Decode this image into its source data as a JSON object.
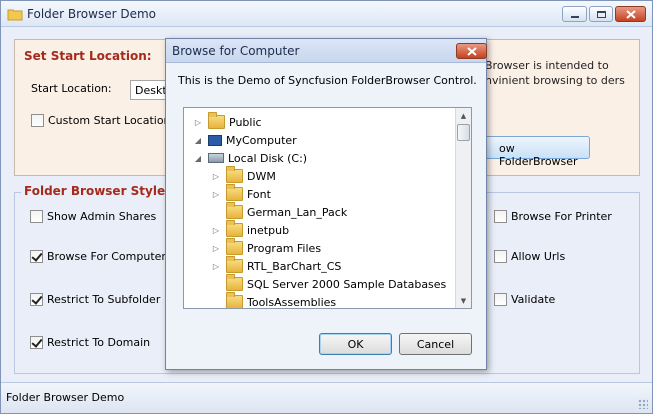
{
  "window": {
    "title": "Folder Browser Demo"
  },
  "start_panel": {
    "header": "Set Start Location:",
    "start_location_label": "Start Location:",
    "start_location_value": "Desktop",
    "custom_start_label": "Custom Start Location",
    "custom_start_checked": false,
    "description": "Browser is intended to nvinient browsing to ders",
    "show_button_label": "ow FolderBrowser"
  },
  "styles_panel": {
    "header": "Folder Browser Styles",
    "options_left": [
      {
        "label": "Show Admin Shares",
        "checked": false
      },
      {
        "label": "Browse For Computer",
        "checked": true
      },
      {
        "label": "Restrict  To Subfolder",
        "checked": true
      },
      {
        "label": "Restrict To Domain",
        "checked": true
      }
    ],
    "options_right": [
      {
        "label": "Browse For Printer",
        "checked": false
      },
      {
        "label": "Allow Urls",
        "checked": false
      },
      {
        "label": "Validate",
        "checked": false
      }
    ]
  },
  "status": {
    "text": "Folder Browser Demo"
  },
  "dialog": {
    "title": "Browse for Computer",
    "message": "This is the Demo of Syncfusion FolderBrowser Control.",
    "tree": [
      {
        "label": "Public",
        "level": 0,
        "expander": "collapsed",
        "icon": "folder-icon"
      },
      {
        "label": "MyComputer",
        "level": 0,
        "expander": "expanded",
        "icon": "computer-icon"
      },
      {
        "label": "Local Disk (C:)",
        "level": 1,
        "expander": "expanded",
        "icon": "disk-icon"
      },
      {
        "label": "DWM",
        "level": 2,
        "expander": "collapsed",
        "icon": "folder-icon"
      },
      {
        "label": "Font",
        "level": 2,
        "expander": "collapsed",
        "icon": "folder-icon"
      },
      {
        "label": "German_Lan_Pack",
        "level": 2,
        "expander": "none",
        "icon": "folder-icon"
      },
      {
        "label": "inetpub",
        "level": 2,
        "expander": "collapsed",
        "icon": "folder-icon"
      },
      {
        "label": "Program Files",
        "level": 2,
        "expander": "collapsed",
        "icon": "folder-icon"
      },
      {
        "label": "RTL_BarChart_CS",
        "level": 2,
        "expander": "collapsed",
        "icon": "folder-icon"
      },
      {
        "label": "SQL Server 2000 Sample Databases",
        "level": 2,
        "expander": "none",
        "icon": "folder-icon"
      },
      {
        "label": "ToolsAssemblies",
        "level": 2,
        "expander": "none",
        "icon": "folder-icon"
      }
    ],
    "ok_label": "OK",
    "cancel_label": "Cancel"
  }
}
